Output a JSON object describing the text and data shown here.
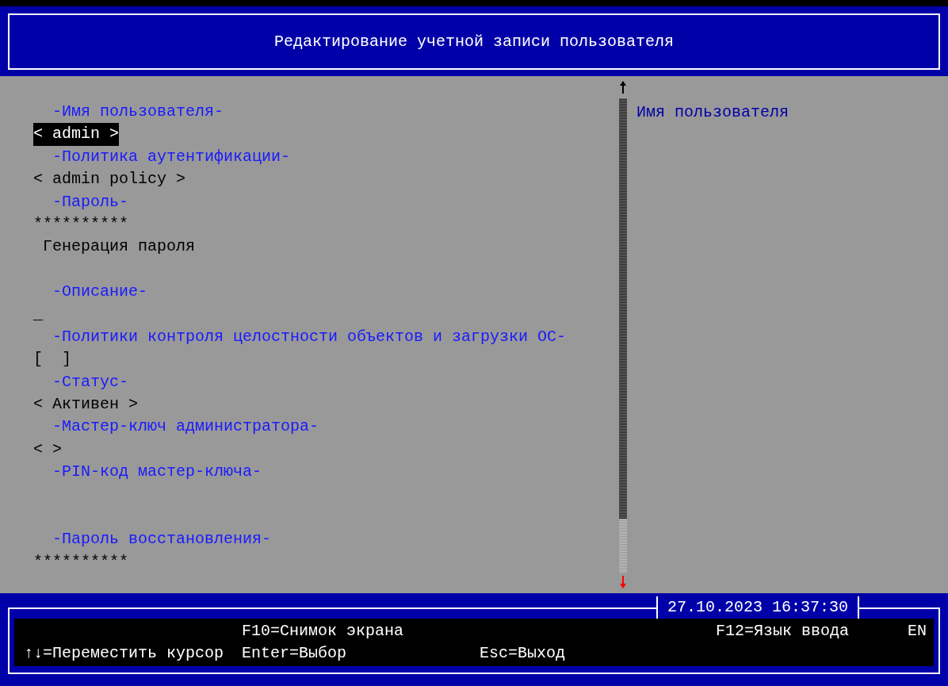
{
  "window": {
    "title": "Редактирование учетной записи пользователя"
  },
  "form": [
    {
      "kind": "label",
      "text": "-Имя пользователя-"
    },
    {
      "kind": "value",
      "text": "< admin >",
      "selected": true
    },
    {
      "kind": "label",
      "text": "-Политика аутентификации-"
    },
    {
      "kind": "value",
      "text": "< admin policy >",
      "selected": false
    },
    {
      "kind": "label",
      "text": "-Пароль-"
    },
    {
      "kind": "value",
      "text": "**********",
      "selected": false
    },
    {
      "kind": "action",
      "text": "Генерация пароля",
      "selected": false
    },
    {
      "kind": "blank"
    },
    {
      "kind": "label",
      "text": "-Описание-"
    },
    {
      "kind": "value",
      "text": "_",
      "selected": false
    },
    {
      "kind": "label",
      "text": "-Политики контроля целостности объектов и загрузки ОС-"
    },
    {
      "kind": "value",
      "text": "[  ]",
      "selected": false
    },
    {
      "kind": "label",
      "text": "-Статус-"
    },
    {
      "kind": "value",
      "text": "< Активен >",
      "selected": false
    },
    {
      "kind": "label",
      "text": "-Мастер-ключ администратора-"
    },
    {
      "kind": "value",
      "text": "< >",
      "selected": false
    },
    {
      "kind": "label",
      "text": "-PIN-код мастер-ключа-"
    },
    {
      "kind": "blank"
    },
    {
      "kind": "blank"
    },
    {
      "kind": "label",
      "text": "-Пароль восстановления-"
    },
    {
      "kind": "value",
      "text": "**********",
      "selected": false
    }
  ],
  "help": {
    "text": "Имя пользователя"
  },
  "status_bar": {
    "datetime": "27.10.2023 16:37:30",
    "keys": [
      {
        "text": "F10=Снимок экрана"
      },
      {
        "text": "F12=Язык ввода"
      },
      {
        "text": "EN"
      },
      {
        "text": "↑↓=Переместить курсор"
      },
      {
        "text": "Enter=Выбор"
      },
      {
        "text": "Esc=Выход"
      }
    ]
  }
}
